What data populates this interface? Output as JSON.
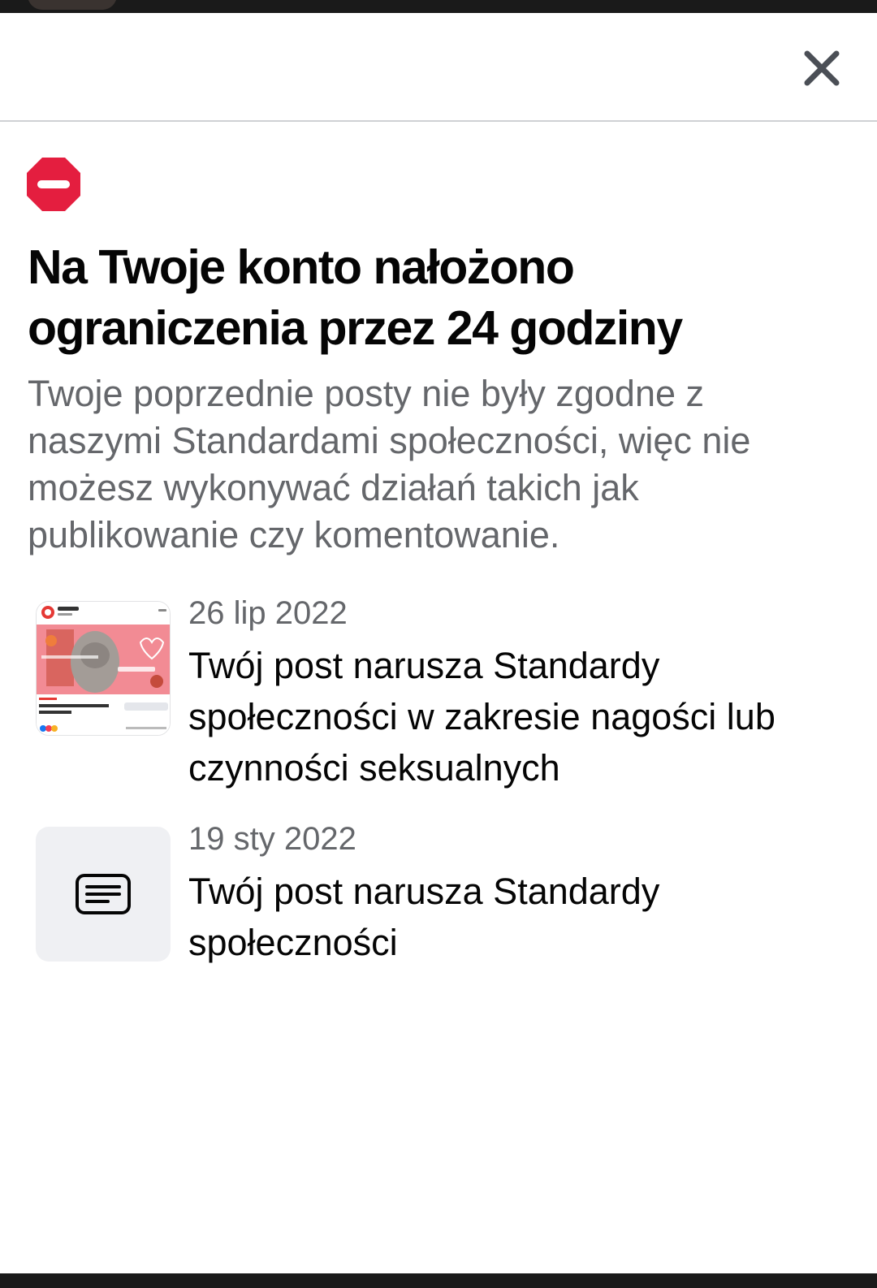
{
  "header": {
    "close_icon": "close-icon"
  },
  "restriction": {
    "icon": "no-entry-icon",
    "icon_color": "#e41e3f",
    "title": "Na Twoje konto nałożono ograniczenia przez 24 godziny",
    "description": "Twoje poprzednie posty nie były zgodne z naszymi Standardami społeczności, więc nie możesz wykonywać działań takich jak publikowanie czy komentowanie."
  },
  "violations": [
    {
      "date": "26 lip 2022",
      "reason": "Twój post narusza Standardy społeczności w zakresie nagości lub czynności seksualnych",
      "thumbnail": "post-preview-image"
    },
    {
      "date": "19 sty 2022",
      "reason": "Twój post narusza Standardy społeczności",
      "thumbnail": "text-post-icon"
    }
  ]
}
